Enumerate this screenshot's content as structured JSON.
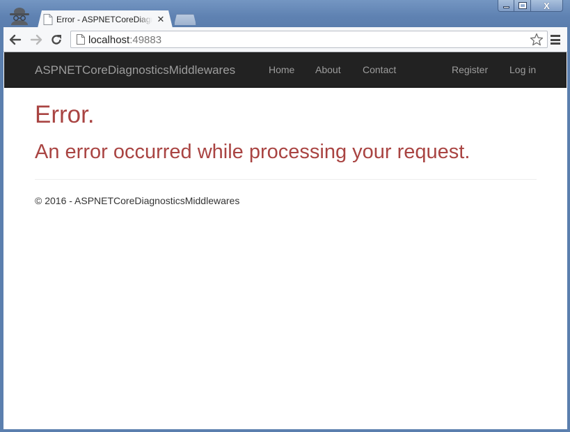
{
  "browser": {
    "tab_title": "Error - ASPNETCoreDiagnosticsMiddlewares",
    "close_glyph": "✕",
    "url_host": "localhost",
    "url_port": ":49883",
    "icons": [
      "incognito-icon",
      "page-favicon",
      "back-icon",
      "forward-icon",
      "reload-icon",
      "page-icon",
      "star-icon",
      "menu-icon",
      "minimize-icon",
      "maximize-icon",
      "close-icon"
    ]
  },
  "navbar": {
    "brand": "ASPNETCoreDiagnosticsMiddlewares",
    "links": [
      "Home",
      "About",
      "Contact"
    ],
    "right_links": [
      "Register",
      "Log in"
    ]
  },
  "main": {
    "heading": "Error.",
    "message": "An error occurred while processing your request."
  },
  "footer": {
    "text": "© 2016 - ASPNETCoreDiagnosticsMiddlewares"
  },
  "colors": {
    "navbar_bg": "#222222",
    "nav_text": "#9d9d9d",
    "error_text": "#a94442",
    "window_frame": "#5b7fae"
  }
}
